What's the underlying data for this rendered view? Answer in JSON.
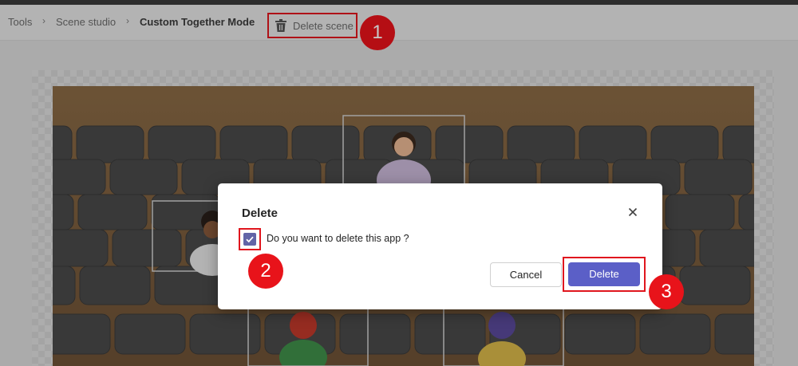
{
  "breadcrumb": {
    "items": [
      "Tools",
      "Scene studio",
      "Custom Together Mode"
    ],
    "separator": "›"
  },
  "toolbar": {
    "delete_scene_label": "Delete scene",
    "delete_scene_icon": "trash-icon"
  },
  "annotations": {
    "step1": "1",
    "step2": "2",
    "step3": "3"
  },
  "dialog": {
    "title": "Delete",
    "close_icon": "close-icon",
    "checkbox_checked": true,
    "question": "Do you want to delete this app ?",
    "cancel_label": "Cancel",
    "delete_label": "Delete"
  },
  "colors": {
    "accent": "#5b5fc7",
    "annotation_red": "#e8131a",
    "checkbox": "#6264a7"
  }
}
